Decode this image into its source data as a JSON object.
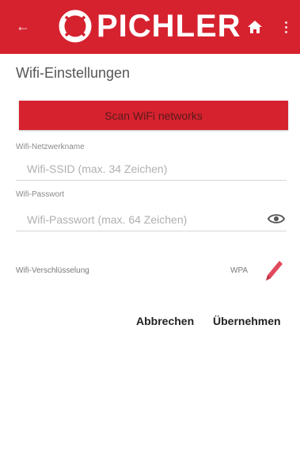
{
  "appbar": {
    "brand": "PICHLER",
    "back_icon": "arrow-back-icon",
    "home_icon": "home-icon",
    "menu_icon": "more-vert-icon",
    "color": "#d6222f"
  },
  "page": {
    "title": "Wifi-Einstellungen"
  },
  "scan": {
    "label": "Scan WiFi networks"
  },
  "ssid": {
    "label": "Wifi-Netzwerkname",
    "placeholder": "Wifi-SSID (max. 34 Zeichen)",
    "value": ""
  },
  "password": {
    "label": "Wifi-Passwort",
    "placeholder": "Wifi-Passwort (max. 64 Zeichen)",
    "value": "",
    "toggle_icon": "eye-icon"
  },
  "encryption": {
    "label": "Wifi-Verschlüsselung",
    "value": "WPA",
    "edit_icon": "pencil-icon"
  },
  "actions": {
    "cancel": "Abbrechen",
    "apply": "Übernehmen"
  }
}
